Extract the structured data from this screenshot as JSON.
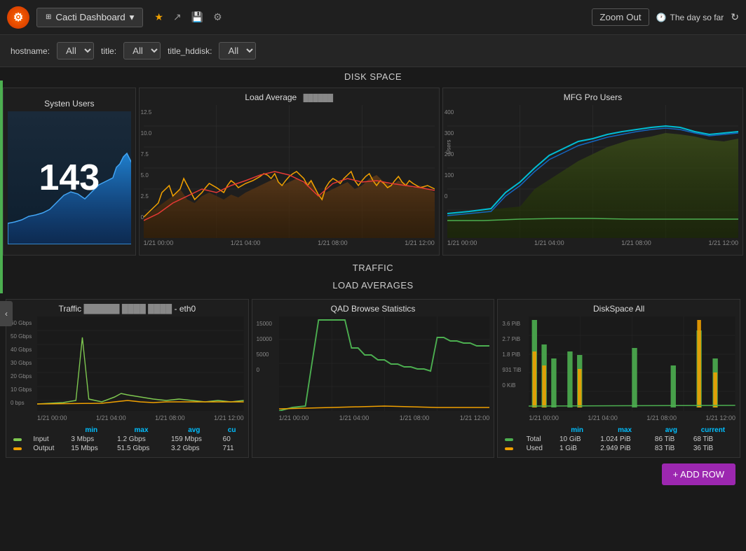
{
  "header": {
    "title": "Cacti Dashboard",
    "zoom_out": "Zoom Out",
    "day_so_far": "The day so far",
    "icons": {
      "star": "★",
      "share": "⬡",
      "save": "💾",
      "gear": "⚙"
    }
  },
  "filters": {
    "hostname_label": "hostname:",
    "hostname_value": "All",
    "title_label": "title:",
    "title_value": "All",
    "title_hddisk_label": "title_hddisk:",
    "title_hddisk_value": "All"
  },
  "sections": {
    "disk_space": "DISK SPACE",
    "traffic": "TRAFFIC",
    "load_averages": "LOAD AVERAGES"
  },
  "charts": {
    "system_users": {
      "title": "Systen Users",
      "value": "143"
    },
    "load_average": {
      "title": "Load Average"
    },
    "mfg_pro_users": {
      "title": "MFG Pro Users"
    },
    "traffic": {
      "title": "Traffic - eth0",
      "min_label": "min",
      "max_label": "max",
      "avg_label": "avg",
      "cur_label": "cu",
      "rows": [
        {
          "color": "#7ec850",
          "label": "Input",
          "min": "3 Mbps",
          "max": "1.2 Gbps",
          "avg": "159 Mbps",
          "cur": "60"
        },
        {
          "color": "#f0a000",
          "label": "Output",
          "min": "15 Mbps",
          "max": "51.5 Gbps",
          "avg": "3.2 Gbps",
          "cur": "711"
        }
      ],
      "y_labels": [
        "60 Gbps",
        "50 Gbps",
        "40 Gbps",
        "30 Gbps",
        "20 Gbps",
        "10 Gbps",
        "0 bps"
      ],
      "x_labels": [
        "1/21 00:00",
        "1/21 04:00",
        "1/21 08:00",
        "1/21 12:00"
      ]
    },
    "qad_browse": {
      "title": "QAD Browse Statistics",
      "y_labels": [
        "15000",
        "10000",
        "5000",
        "0"
      ],
      "x_labels": [
        "1/21 00:00",
        "1/21 04:00",
        "1/21 08:00",
        "1/21 12:00"
      ]
    },
    "diskspace_all": {
      "title": "DiskSpace All",
      "min_label": "min",
      "max_label": "max",
      "avg_label": "avg",
      "cur_label": "current",
      "rows": [
        {
          "color": "#7ec850",
          "label": "Total",
          "min": "10 GiB",
          "max": "1.024 PiB",
          "avg": "86 TiB",
          "cur": "68 TiB"
        },
        {
          "color": "#f0a000",
          "label": "Used",
          "min": "1 GiB",
          "max": "2.949 PiB",
          "avg": "83 TiB",
          "cur": "36 TiB"
        }
      ],
      "y_labels": [
        "3.6 PiB",
        "2.7 PiB",
        "1.8 PiB",
        "931 TiB",
        "0 KiB"
      ],
      "x_labels": [
        "1/21 00:00",
        "1/21 04:00",
        "1/21 08:00",
        "1/21 12:00"
      ]
    }
  },
  "buttons": {
    "add_row": "+ ADD ROW"
  }
}
